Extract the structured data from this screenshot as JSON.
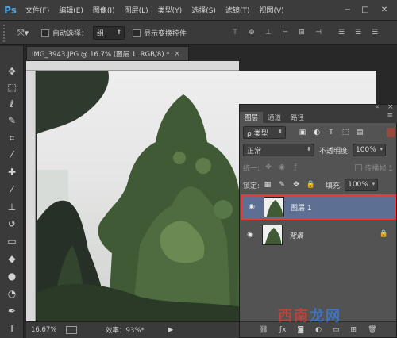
{
  "app": {
    "logo": "Ps",
    "menu": [
      "文件(F)",
      "编辑(E)",
      "图像(I)",
      "图层(L)",
      "类型(Y)",
      "选择(S)",
      "滤镜(T)",
      "视图(V)"
    ],
    "window_controls": {
      "minimize": "−",
      "restore": "□",
      "close": "✕"
    }
  },
  "options": {
    "auto_select_label": "自动选择：",
    "auto_select_value": "组",
    "transform_label": "显示变换控件"
  },
  "document": {
    "tab_title": "IMG_3943.JPG @ 16.7% (图层 1, RGB/8) *",
    "close": "×",
    "zoom": "16.67%",
    "efficiency": "效率：93%*",
    "status_arrow": "▶"
  },
  "layers_panel": {
    "tabs": [
      "图层",
      "通道",
      "路径"
    ],
    "filter_kind": "ρ 类型",
    "blend_mode": "正常",
    "opacity_label": "不透明度:",
    "opacity_value": "100%",
    "unify_label": "统一:",
    "propagate_label": "传播帧 1",
    "lock_label": "锁定:",
    "fill_label": "填充:",
    "fill_value": "100%",
    "layers": [
      {
        "name": "图层 1",
        "visible": true,
        "selected": true,
        "italic": false
      },
      {
        "name": "背景",
        "visible": true,
        "selected": false,
        "italic": true,
        "locked": true
      }
    ]
  },
  "watermark": {
    "part1": "西",
    "part2": "南",
    "part3": "龙",
    "part4": "网"
  },
  "colors": {
    "accent": "#4fa3e0",
    "selection_border": "#e43a3a",
    "layer_selected_bg": "#5d6f92"
  }
}
